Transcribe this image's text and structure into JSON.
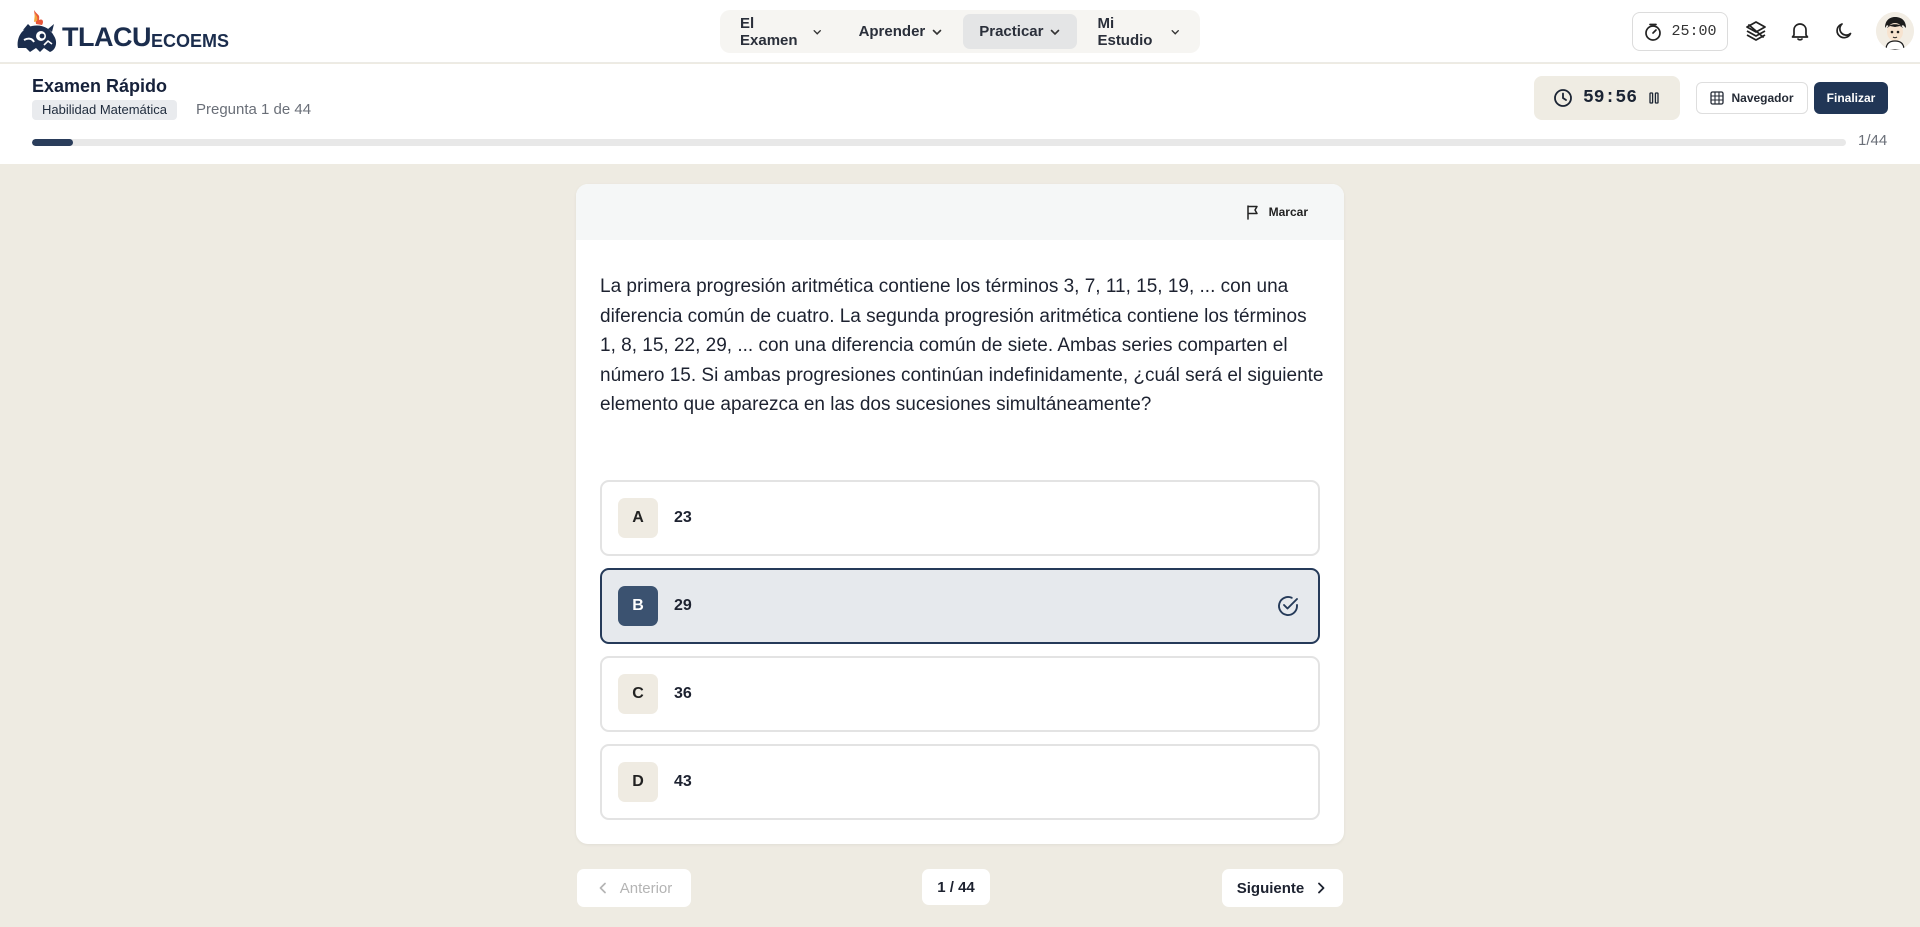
{
  "brand": {
    "name_main": "TLACU",
    "name_sub": "ECOEMS",
    "primary_color": "#213656"
  },
  "topnav": {
    "menu": [
      {
        "label": "El Examen",
        "active": false
      },
      {
        "label": "Aprender",
        "active": false
      },
      {
        "label": "Practicar",
        "active": true
      },
      {
        "label": "Mi Estudio",
        "active": false
      }
    ],
    "pomodoro": "25:00",
    "icons": [
      "timer-icon",
      "layers-icon",
      "bell-icon",
      "moon-icon",
      "avatar"
    ]
  },
  "exam": {
    "title": "Examen Rápido",
    "subject": "Habilidad Matemática",
    "question_count": "Pregunta 1 de 44",
    "timer": "59:56",
    "navigator_label": "Navegador",
    "finish_label": "Finalizar",
    "progress_fraction": 0.0227,
    "progress_label": "1/44"
  },
  "question": {
    "flag_label": "Marcar",
    "text": "La primera progresión aritmética contiene los términos 3, 7, 11, 15, 19, ... con una diferencia común de cuatro. La segunda progresión aritmética contiene los términos 1, 8, 15, 22, 29, ... con una diferencia común de siete. Ambas series comparten el número 15. Si ambas progresiones continúan indefinidamente, ¿cuál será el siguiente elemento que aparezca en las dos sucesiones simultáneamente?",
    "options": [
      {
        "letter": "A",
        "text": "23",
        "selected": false
      },
      {
        "letter": "B",
        "text": "29",
        "selected": true
      },
      {
        "letter": "C",
        "text": "36",
        "selected": false
      },
      {
        "letter": "D",
        "text": "43",
        "selected": false
      }
    ]
  },
  "footer": {
    "prev_label": "Anterior",
    "page_indicator": "1 / 44",
    "next_label": "Siguiente"
  }
}
